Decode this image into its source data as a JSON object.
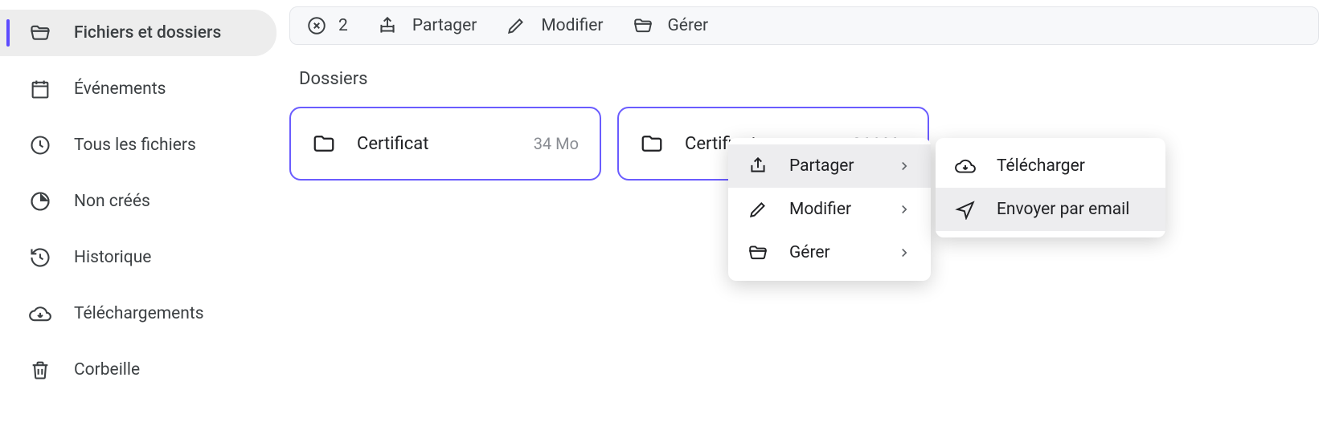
{
  "sidebar": {
    "items": [
      {
        "label": "Fichiers et dossiers"
      },
      {
        "label": "Événements"
      },
      {
        "label": "Tous les fichiers"
      },
      {
        "label": "Non créés"
      },
      {
        "label": "Historique"
      },
      {
        "label": "Téléchargements"
      },
      {
        "label": "Corbeille"
      }
    ]
  },
  "action_bar": {
    "selected_count": "2",
    "share": "Partager",
    "edit": "Modifier",
    "manage": "Gérer"
  },
  "section_title": "Dossiers",
  "folders": [
    {
      "name": "Certificat",
      "size": "34 Mo"
    },
    {
      "name": "Certificat",
      "size": "364 Mo"
    }
  ],
  "context_menu": {
    "share": "Partager",
    "edit": "Modifier",
    "manage": "Gérer"
  },
  "share_submenu": {
    "download": "Télécharger",
    "email": "Envoyer par email"
  }
}
